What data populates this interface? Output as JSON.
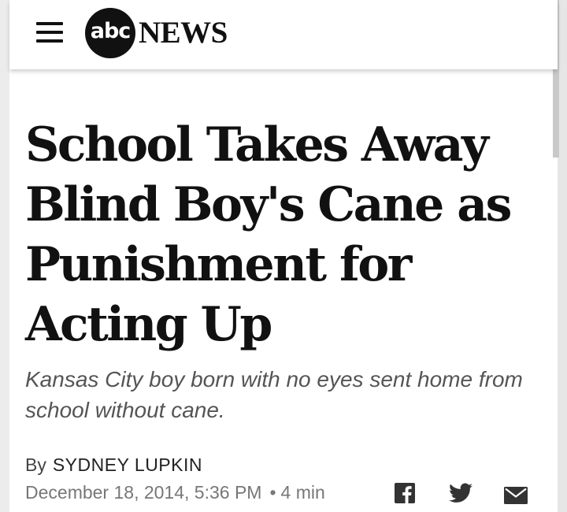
{
  "header": {
    "logo_abc": "abc",
    "logo_news": "NEWS"
  },
  "article": {
    "headline": "School Takes Away Blind Boy's Cane as Punishment for Acting Up",
    "subhead": "Kansas City boy born with no eyes sent home from school without cane.",
    "by_prefix": "By",
    "author": "SYDNEY LUPKIN",
    "date": "December 18, 2014, 5:36 PM",
    "separator": "•",
    "read_time": "4 min"
  },
  "share": {
    "icons": [
      "facebook-icon",
      "twitter-icon",
      "email-icon"
    ]
  },
  "colors": {
    "text": "#111111",
    "subhead": "#555555",
    "meta": "#777777",
    "icon": "#333333"
  }
}
